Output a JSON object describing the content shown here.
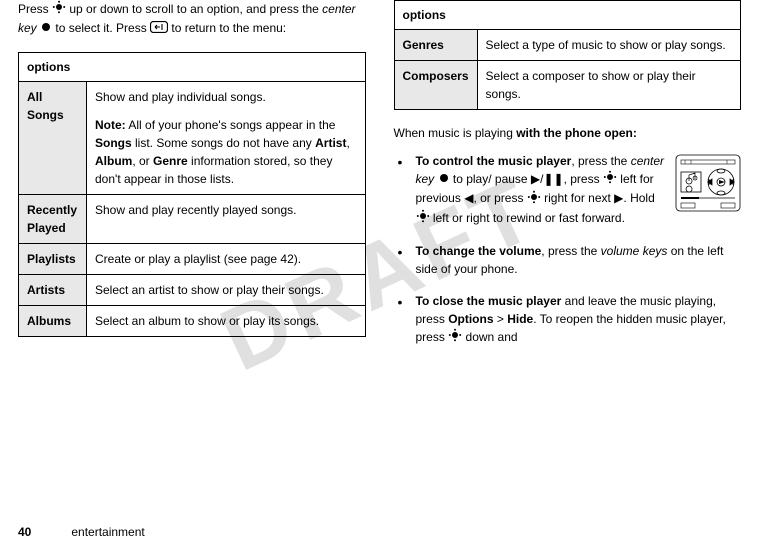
{
  "watermark": "DRAFT",
  "intro": {
    "prefix": "Press ",
    "nav_icon": "nav-4way-icon",
    "mid1": " up or down to scroll to an option, and press the ",
    "center_key_label": "center key",
    "center_icon": "center-key-icon",
    "mid2": " to select it. Press ",
    "back_icon": "back-key-icon",
    "suffix": " to return to the menu:"
  },
  "options_label": "options",
  "table1": {
    "rows": [
      {
        "label": "All Songs",
        "desc": "Show and play individual songs.",
        "note_label": "Note:",
        "note_part1": " All of your phone's songs appear in the ",
        "note_songs": "Songs",
        "note_part2": " list. Some songs do not have any ",
        "note_artist": "Artist",
        "note_comma1": ", ",
        "note_album": "Album",
        "note_comma2": ", or ",
        "note_genre": "Genre",
        "note_part3": " information stored, so they don't appear in those lists."
      },
      {
        "label": "Recently Played",
        "desc": "Show and play recently played songs."
      },
      {
        "label": "Playlists",
        "desc": "Create or play a playlist (see page 42)."
      },
      {
        "label": "Artists",
        "desc": "Select an artist to show or play their songs."
      },
      {
        "label": "Albums",
        "desc": "Select an album to show or play its songs."
      }
    ]
  },
  "table2": {
    "rows": [
      {
        "label": "Genres",
        "desc": "Select a type of music to show or play songs."
      },
      {
        "label": "Composers",
        "desc": "Select a composer to show or play their songs."
      }
    ]
  },
  "playing_header": {
    "prefix": "When music is playing ",
    "bold": "with the phone open:"
  },
  "bullets": {
    "b1": {
      "bold": "To control the music player",
      "t1": ", press the ",
      "center_key": "center key",
      "t2": " to play/ pause ",
      "play_pause": "▶/❚❚",
      "t3": ", press ",
      "t4": " left for previous ",
      "prev": "◀",
      "t5": ", or press ",
      "t6": " right for next ",
      "next": "▶",
      "t7": ". Hold ",
      "t8": " left or right to rewind or fast forward."
    },
    "b2": {
      "bold": "To change the volume",
      "t1": ", press the ",
      "volkeys": "volume keys",
      "t2": " on the left side of your phone."
    },
    "b3": {
      "bold": "To close the music player",
      "t1": " and leave the music playing, press ",
      "options": "Options",
      "gt": " > ",
      "hide": "Hide",
      "t2": ". To reopen the hidden music player, press ",
      "t3": " down and"
    }
  },
  "footer": {
    "page": "40",
    "section": "entertainment"
  }
}
